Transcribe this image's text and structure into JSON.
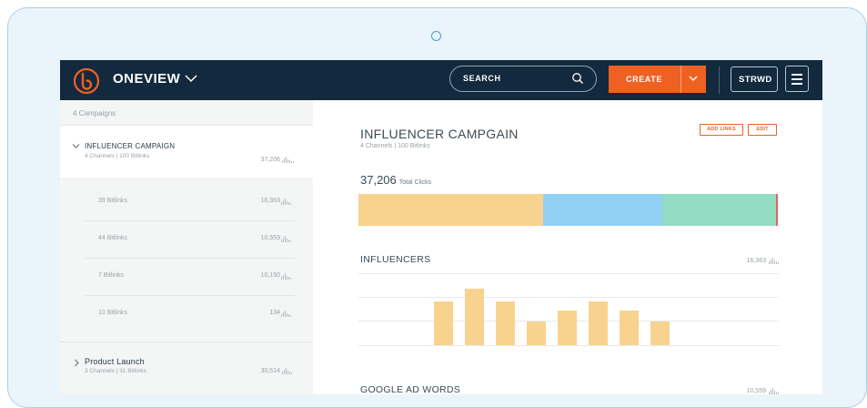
{
  "theme": {
    "navbar_bg": "#13293d",
    "accent": "#ee6123",
    "bar_yellow": "#f8d38f",
    "bar_blue": "#93d1f3",
    "bar_green": "#93dcc3",
    "bar_red": "#e86060"
  },
  "header": {
    "brand": "ONEVIEW",
    "search_label": "SEARCH",
    "create_label": "CREATE",
    "account_label": "STRWD"
  },
  "sidebar": {
    "count_label": "4 Campaigns",
    "campaigns": [
      {
        "title": "INFLUENCER CAMPAIGN",
        "subtitle": "4 Channels  |  100 Bitlinks",
        "value": "37,206",
        "expanded": true,
        "children": [
          {
            "label": "39 Bitlinks",
            "value": "16,363"
          },
          {
            "label": "44 Bitlinks",
            "value": "10,559"
          },
          {
            "label": "7 Bitlinks",
            "value": "10,150"
          },
          {
            "label": "10 Bitlinks",
            "value": "134"
          }
        ]
      },
      {
        "title": "Product Launch",
        "subtitle": "3 Channels  |  31 Bitlinks",
        "value": "30,514",
        "expanded": false
      }
    ]
  },
  "main": {
    "title": "INFLUENCER CAMPGAIN",
    "subtitle": "4 Channels  |  100 Bitlinks",
    "add_links_label": "ADD LINKS",
    "edit_label": "EDIT",
    "total_value": "37,206",
    "total_label": "Total Clicks",
    "sections": [
      {
        "title": "INFLUENCERS",
        "value": "16,363"
      },
      {
        "title": "GOOGLE AD WORDS",
        "value": "10,559"
      }
    ]
  },
  "chart_data": [
    {
      "type": "bar",
      "name": "Total Clicks breakdown",
      "orientation": "horizontal-stacked",
      "series": [
        {
          "value": 16363,
          "color": "#f8d38f"
        },
        {
          "value": 10559,
          "color": "#93d1f3"
        },
        {
          "value": 10150,
          "color": "#93dcc3"
        },
        {
          "value": 134,
          "color": "#e86060"
        }
      ]
    },
    {
      "type": "bar",
      "name": "INFLUENCERS",
      "values": [
        44,
        56,
        44,
        24,
        35,
        44,
        35,
        24
      ],
      "ylim": [
        0,
        60
      ],
      "grid": true
    }
  ]
}
